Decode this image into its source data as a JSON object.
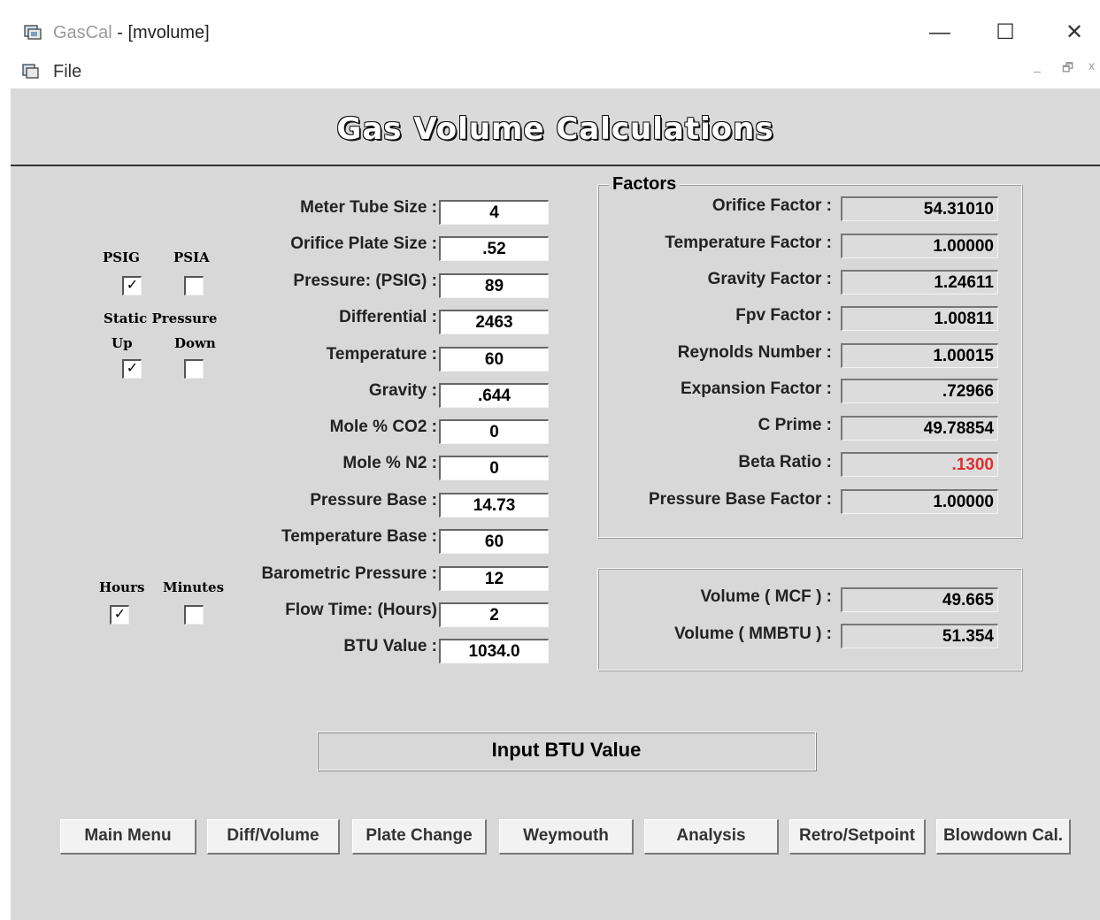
{
  "window": {
    "app_name": "GasCal",
    "doc_title": " - [mvolume]",
    "minimize": "—",
    "maximize": "☐",
    "close": "✕"
  },
  "menu": {
    "file_label": "File",
    "mdi_controls": [
      "_",
      "🗗",
      "x"
    ]
  },
  "heading": "Gas Volume Calculations",
  "checkboxes": {
    "psig_label": "PSIG",
    "psia_label": "PSIA",
    "psig_checked": "✓",
    "psia_checked": "",
    "static_pressure_label": "Static Pressure",
    "up_label": "Up",
    "down_label": "Down",
    "up_checked": "✓",
    "down_checked": "",
    "hours_label": "Hours",
    "minutes_label": "Minutes",
    "hours_checked": "✓",
    "minutes_checked": ""
  },
  "inputs": [
    {
      "label": "Meter Tube Size :",
      "value": "4"
    },
    {
      "label": "Orifice Plate Size :",
      "value": ".52"
    },
    {
      "label": "Pressure: (PSIG) :",
      "value": "89"
    },
    {
      "label": "Differential :",
      "value": "2463"
    },
    {
      "label": "Temperature :",
      "value": "60"
    },
    {
      "label": "Gravity :",
      "value": ".644"
    },
    {
      "label": "Mole % CO2 :",
      "value": "0"
    },
    {
      "label": "Mole % N2 :",
      "value": "0"
    },
    {
      "label": "Pressure Base :",
      "value": "14.73"
    },
    {
      "label": "Temperature Base :",
      "value": "60"
    },
    {
      "label": "Barometric Pressure :",
      "value": "12"
    },
    {
      "label": "Flow Time: (Hours)",
      "value": "2"
    },
    {
      "label": "BTU Value :",
      "value": "1034.0"
    }
  ],
  "factors": {
    "title": "Factors",
    "items": [
      {
        "label": "Orifice Factor :",
        "value": "54.31010"
      },
      {
        "label": "Temperature Factor :",
        "value": "1.00000"
      },
      {
        "label": "Gravity Factor :",
        "value": "1.24611"
      },
      {
        "label": "Fpv Factor :",
        "value": "1.00811"
      },
      {
        "label": "Reynolds Number :",
        "value": "1.00015"
      },
      {
        "label": "Expansion Factor :",
        "value": ".72966"
      },
      {
        "label": "C Prime :",
        "value": "49.78854"
      },
      {
        "label": "Beta Ratio :",
        "value": ".1300"
      },
      {
        "label": "Pressure Base Factor :",
        "value": "1.00000"
      }
    ],
    "beta_color": "#e03030"
  },
  "volume": {
    "mcf_label": "Volume ( MCF ) :",
    "mcf_value": "49.665",
    "mmbtu_label": "Volume ( MMBTU ) :",
    "mmbtu_value": "51.354"
  },
  "status": "Input BTU Value",
  "buttons": [
    "Main Menu",
    "Diff/Volume",
    "Plate Change",
    "Weymouth",
    "Analysis",
    "Retro/Setpoint",
    "Blowdown Cal."
  ]
}
